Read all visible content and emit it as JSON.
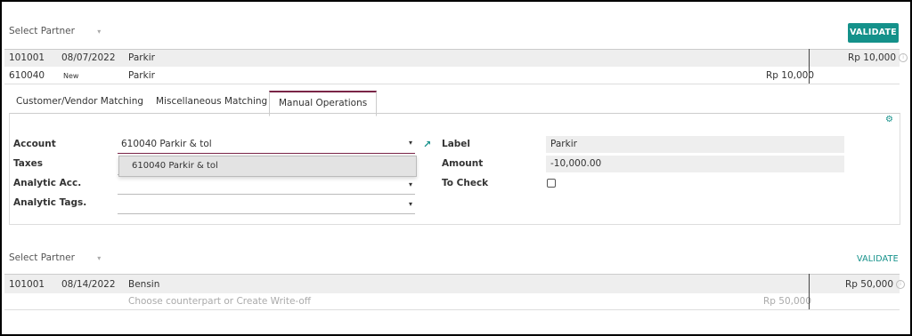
{
  "top": {
    "partner_placeholder": "Select Partner",
    "validate_label": "VALIDATE",
    "line1": {
      "code": "101001",
      "date": "08/07/2022",
      "label": "Parkir",
      "amount": "Rp 10,000"
    },
    "line2": {
      "code": "610040",
      "tag": "New",
      "label": "Parkir",
      "amount": "Rp 10,000"
    }
  },
  "tabs": [
    {
      "label": "Customer/Vendor Matching"
    },
    {
      "label": "Miscellaneous Matching"
    },
    {
      "label": "Manual Operations"
    }
  ],
  "form": {
    "account_label": "Account",
    "account_value": "610040 Parkir & tol",
    "dropdown_option": "610040 Parkir & tol",
    "taxes_label": "Taxes",
    "analytic_acc_label": "Analytic Acc.",
    "analytic_tags_label": "Analytic Tags.",
    "label_label": "Label",
    "label_value": "Parkir",
    "amount_label": "Amount",
    "amount_value": "-10,000.00",
    "to_check_label": "To Check"
  },
  "bottom": {
    "partner_placeholder": "Select Partner",
    "validate_label": "VALIDATE",
    "line1": {
      "code": "101001",
      "date": "08/14/2022",
      "label": "Bensin",
      "amount": "Rp 50,000"
    },
    "line2": {
      "placeholder": "Choose counterpart or Create Write-off",
      "amount": "Rp 50,000"
    }
  },
  "colors": {
    "accent": "#14918a",
    "active_tab": "#7a2547"
  },
  "icons": [
    "chevron-down-icon",
    "info-icon",
    "external-link-icon",
    "gear-icon"
  ]
}
